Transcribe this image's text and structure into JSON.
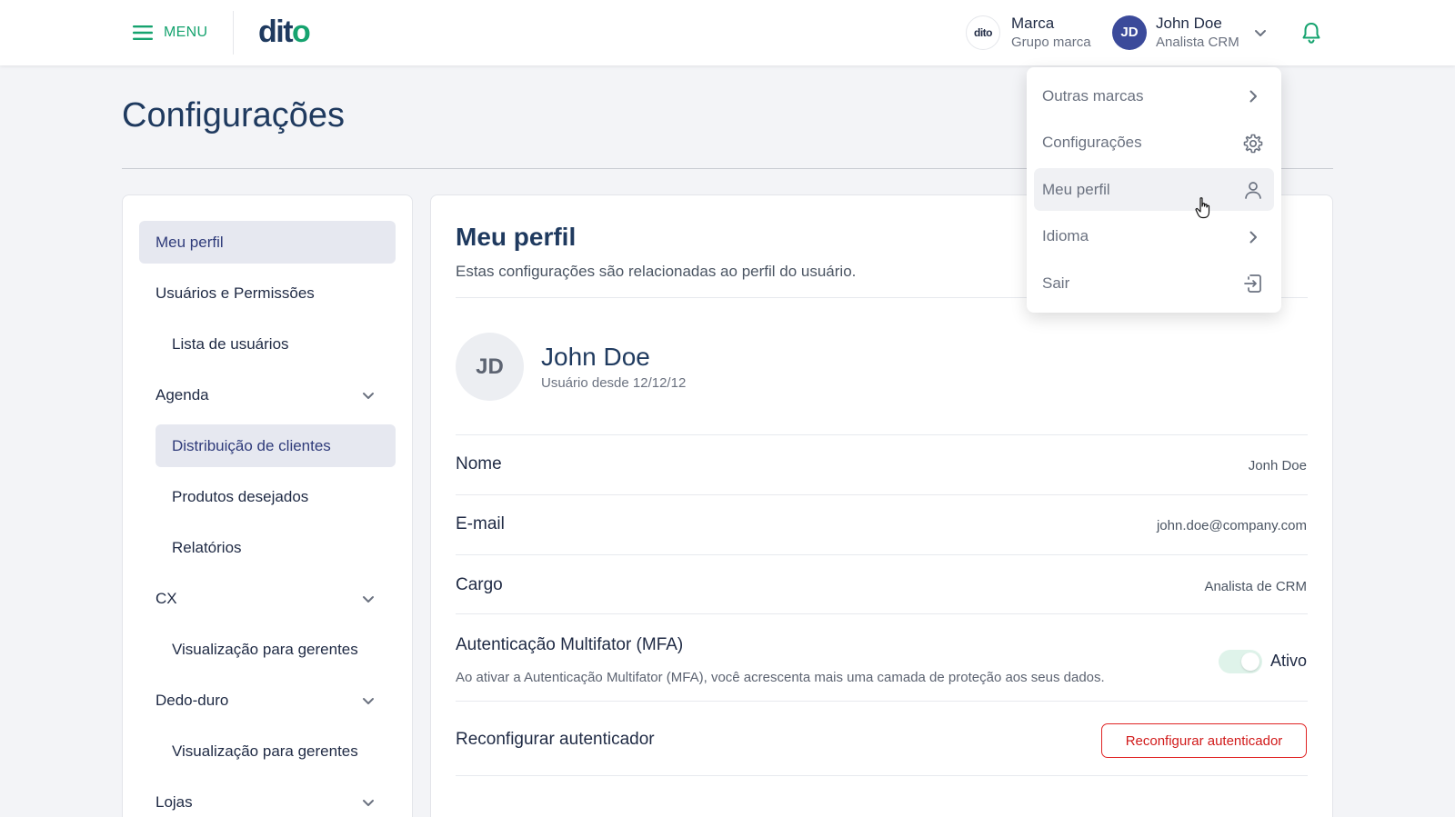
{
  "header": {
    "menu_label": "MENU",
    "logo_text": "dito",
    "brand": {
      "logo_text": "dito",
      "name": "Marca",
      "group": "Grupo marca"
    },
    "user": {
      "initials": "JD",
      "name": "John Doe",
      "role": "Analista CRM"
    }
  },
  "page_title": "Configurações",
  "sidebar": {
    "items": [
      {
        "label": "Meu perfil"
      },
      {
        "label": "Usuários e Permissões"
      },
      {
        "label": "Lista de usuários"
      },
      {
        "label": "Agenda"
      },
      {
        "label": "Distribuição de clientes"
      },
      {
        "label": "Produtos desejados"
      },
      {
        "label": "Relatórios"
      },
      {
        "label": "CX"
      },
      {
        "label": "Visualização para gerentes"
      },
      {
        "label": "Dedo-duro"
      },
      {
        "label": "Visualização para gerentes"
      },
      {
        "label": "Lojas"
      }
    ]
  },
  "main": {
    "title": "Meu perfil",
    "subtitle": "Estas configurações são relacionadas ao perfil do usuário.",
    "profile": {
      "initials": "JD",
      "name": "John Doe",
      "since": "Usuário desde 12/12/12"
    },
    "fields": [
      {
        "label": "Nome",
        "value": "Jonh Doe"
      },
      {
        "label": "E-mail",
        "value": "john.doe@company.com"
      },
      {
        "label": "Cargo",
        "value": "Analista de CRM"
      }
    ],
    "mfa": {
      "label": "Autenticação Multifator (MFA)",
      "description": "Ao ativar a Autenticação Multifator (MFA), você acrescenta mais uma camada de proteção aos seus dados.",
      "enabled": true,
      "status": "Ativo"
    },
    "reconfigure": {
      "label": "Reconfigurar autenticador",
      "button": "Reconfigurar autenticador"
    }
  },
  "dropdown": {
    "items": [
      {
        "label": "Outras marcas",
        "icon": "chevron-right-icon"
      },
      {
        "label": "Configurações",
        "icon": "gear-icon"
      },
      {
        "label": "Meu perfil",
        "icon": "user-icon"
      },
      {
        "label": "Idioma",
        "icon": "chevron-right-icon"
      },
      {
        "label": "Sair",
        "icon": "logout-icon"
      }
    ]
  },
  "colors": {
    "accent_green": "#16a36f",
    "brand_navy": "#1f3a5f",
    "avatar_blue": "#3b4a9a",
    "danger_red": "#e02424"
  }
}
